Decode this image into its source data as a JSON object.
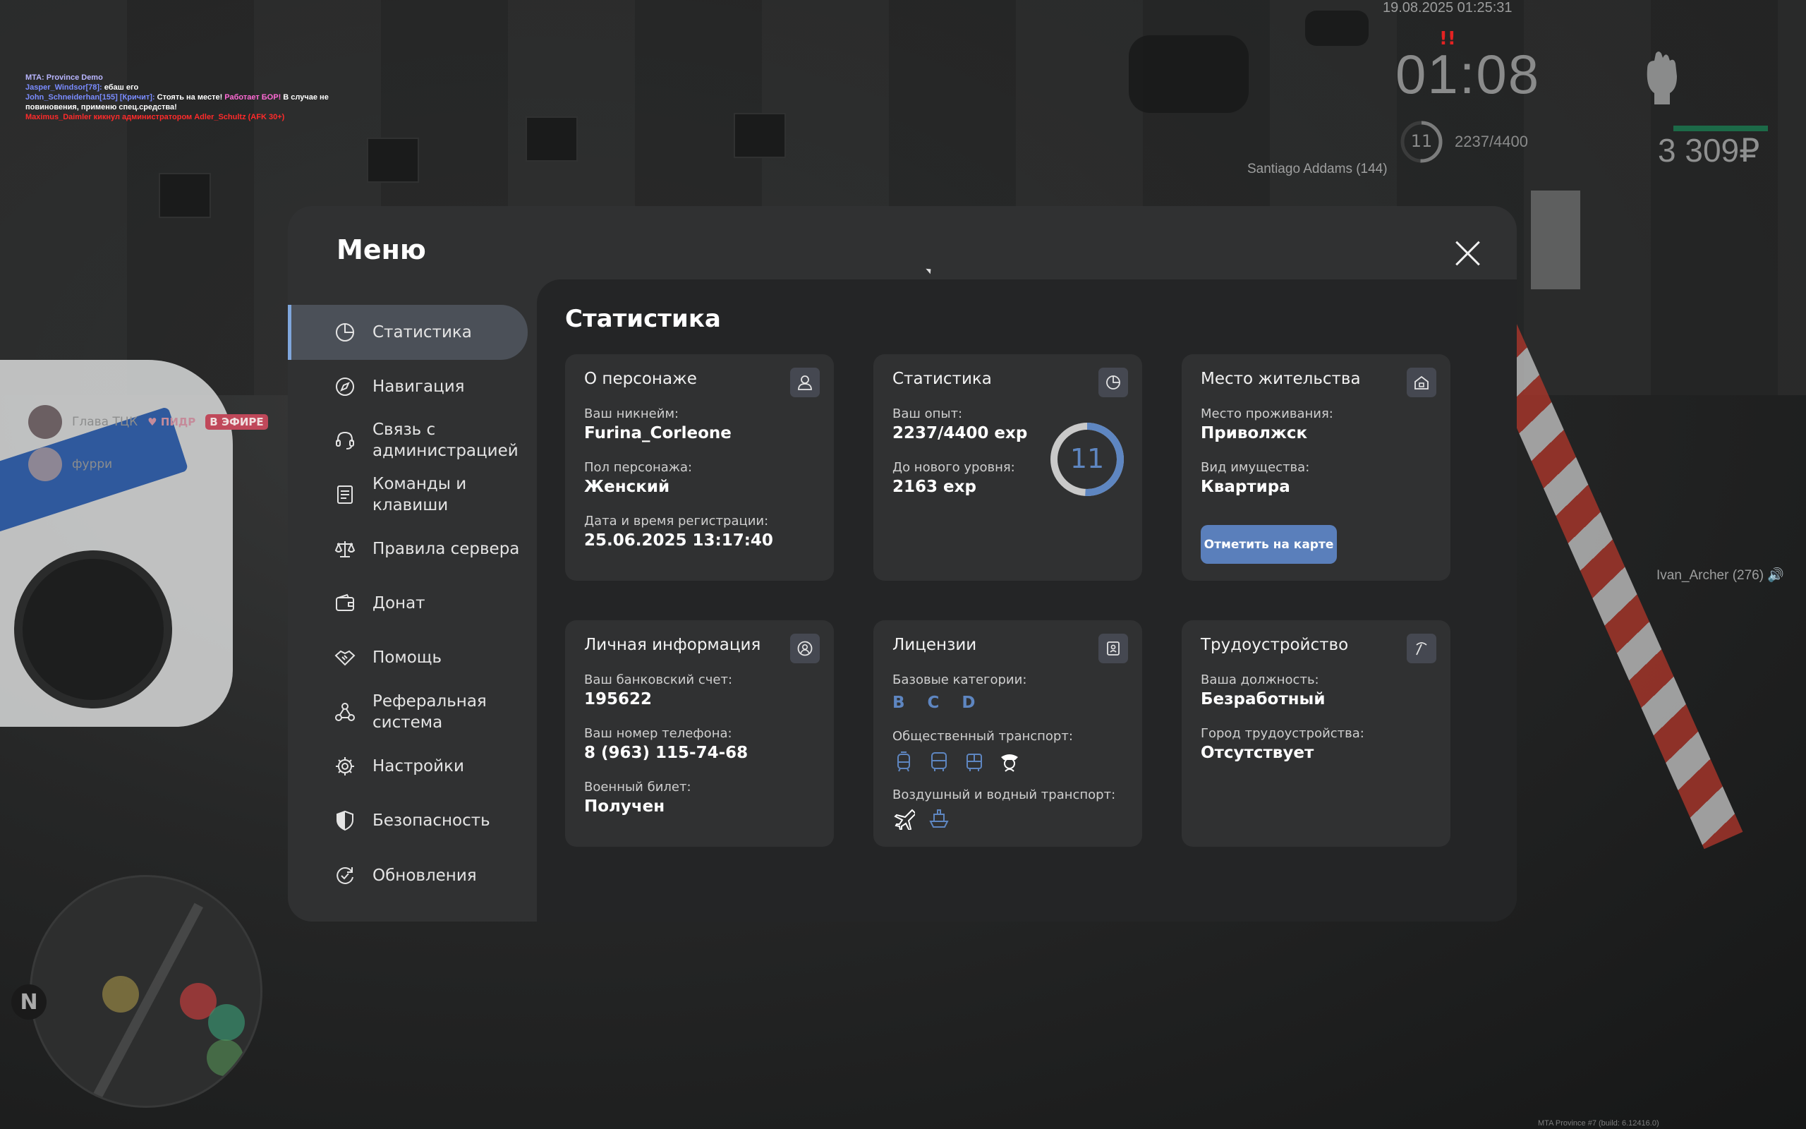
{
  "hud": {
    "date": "19.08.2025 01:25:31",
    "alert": "!!",
    "time": "01:08",
    "level": "11",
    "exp": "2237/4400",
    "money": "3 309₽",
    "health_fraction": 1.0,
    "exp_fraction": 0.508,
    "nearby_player_1": "Santiago Addams (144)",
    "nearby_player_2": "Ivan_Archer (276)",
    "build": "MTA Province #7 (build: 6.12416.0)"
  },
  "chat": {
    "line1": "MTA: Province Demo",
    "line2_name": "Jasper_Windsor[78]:",
    "line2_text": " ебаш его",
    "line3_name": "John_Schneiderhan[155] [Кричит]:",
    "line3_text": " Стоять на месте!",
    "line3_pink": " Работает БОР!",
    "line3_text2": " В случае не",
    "line4_text": "повиновения, применю спец.средства!",
    "line5_text": "Maximus_Daimler кикнул администратором Adler_Schultz (AFK 30+)"
  },
  "voice": [
    {
      "name": "Глава ТЦК",
      "tag": "ПИДР",
      "badge": "В ЭФИРЕ"
    },
    {
      "name": "фурри"
    }
  ],
  "minimap": {
    "north": "N"
  },
  "menu": {
    "title": "Меню",
    "nav": [
      {
        "label": "Статистика",
        "icon": "pie-chart-icon",
        "active": true
      },
      {
        "label": "Навигация",
        "icon": "compass-icon"
      },
      {
        "label": "Связь с администрацией",
        "icon": "headset-icon"
      },
      {
        "label": "Команды и клавиши",
        "icon": "document-icon"
      },
      {
        "label": "Правила сервера",
        "icon": "scales-icon"
      },
      {
        "label": "Донат",
        "icon": "wallet-icon"
      },
      {
        "label": "Помощь",
        "icon": "handshake-icon"
      },
      {
        "label": "Реферальная система",
        "icon": "network-icon"
      },
      {
        "label": "Настройки",
        "icon": "gear-icon"
      },
      {
        "label": "Безопасность",
        "icon": "shield-icon"
      },
      {
        "label": "Обновления",
        "icon": "refresh-check-icon"
      }
    ],
    "content_title": "Статистика",
    "cards": {
      "character": {
        "title": "О персонаже",
        "icon": "user-icon",
        "nickname_label": "Ваш никнейм:",
        "nickname": "Furina_Corleone",
        "gender_label": "Пол персонажа:",
        "gender": "Женский",
        "reg_label": "Дата и время регистрации:",
        "reg": "25.06.2025 13:17:40"
      },
      "stats": {
        "title": "Статистика",
        "icon": "pie-chart-icon",
        "exp_label": "Ваш опыт:",
        "exp": "2237/4400 exp",
        "next_label": "До нового уровня:",
        "next": "2163 exp",
        "level": "11",
        "level_progress": 0.508
      },
      "residence": {
        "title": "Место жительства",
        "icon": "house-icon",
        "place_label": "Место проживания:",
        "place": "Приволжск",
        "property_label": "Вид имущества:",
        "property": "Квартира",
        "button": "Отметить на карте"
      },
      "personal": {
        "title": "Личная информация",
        "icon": "user-circle-icon",
        "bank_label": "Ваш банковский счет:",
        "bank": "195622",
        "phone_label": "Ваш номер телефона:",
        "phone": "8 (963) 115-74-68",
        "military_label": "Военный билет:",
        "military": "Получен"
      },
      "licenses": {
        "title": "Лицензии",
        "icon": "id-card-icon",
        "base_label": "Базовые категории:",
        "base": "B C D",
        "public_label": "Общественный транспорт:",
        "public_icons": [
          "tram-icon",
          "bus-icon",
          "trolleybus-icon",
          "driver-cap-icon"
        ],
        "air_label": "Воздушный и водный транспорт:",
        "air_icons": [
          "airplane-icon",
          "ship-icon"
        ]
      },
      "job": {
        "title": "Трудоустройство",
        "icon": "pickaxe-icon",
        "position_label": "Ваша должность:",
        "position": "Безработный",
        "city_label": "Город трудоустройства:",
        "city": "Отсутствует"
      }
    }
  },
  "colors": {
    "accent": "#5a7fbb",
    "panel": "#303132",
    "content": "#242526",
    "level_ring_fill": "#5e86c1",
    "level_ring_track": "#c9c9c9"
  }
}
